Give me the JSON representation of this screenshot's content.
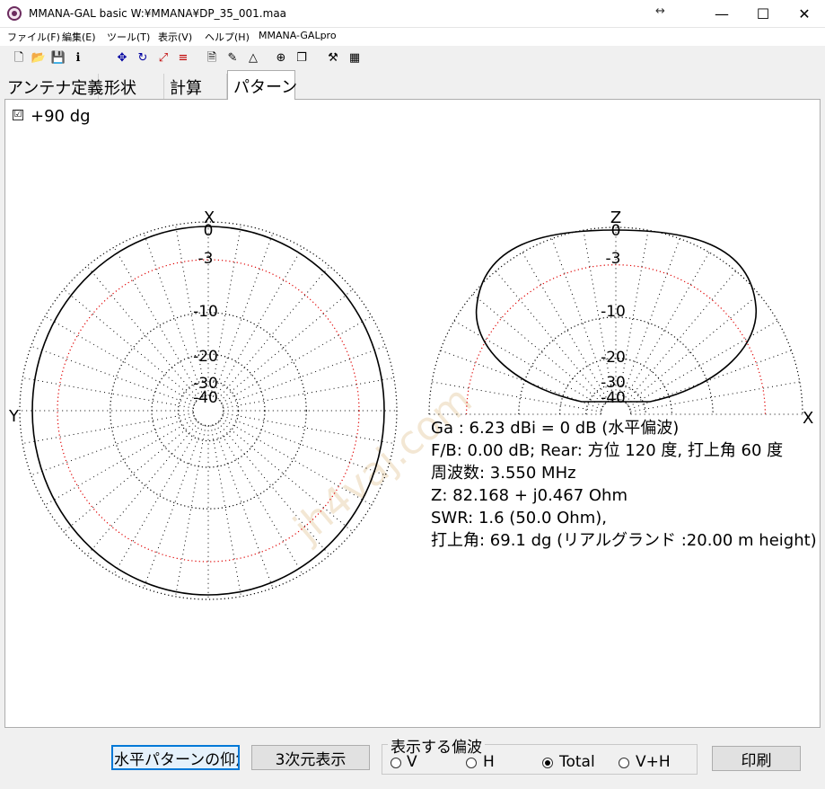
{
  "window": {
    "title": "MMANA-GAL basic  W:¥MMANA¥DP_35_001.maa",
    "minimize": "—",
    "maximize": "☐",
    "close": "✕",
    "resize_glyph": "↔"
  },
  "menu": [
    "ファイル(F)",
    "編集(E)",
    "ツール(T)",
    "表示(V)",
    "ヘルプ(H)",
    "MMANA-GALpro"
  ],
  "toolbar": [
    {
      "icon": "new-file-icon",
      "glyph": "🗋"
    },
    {
      "icon": "open-folder-icon",
      "glyph": "📂"
    },
    {
      "icon": "save-icon",
      "glyph": "💾"
    },
    {
      "icon": "info-icon",
      "glyph": "ℹ"
    },
    {
      "icon": "move-icon",
      "glyph": "✥"
    },
    {
      "icon": "rotate-icon",
      "glyph": "↻"
    },
    {
      "icon": "scale-icon",
      "glyph": "⤢"
    },
    {
      "icon": "wire-list-icon",
      "glyph": "≡"
    },
    {
      "icon": "document-icon",
      "glyph": "🗎"
    },
    {
      "icon": "edit-icon",
      "glyph": "✎"
    },
    {
      "icon": "triangle-icon",
      "glyph": "△"
    },
    {
      "icon": "target-icon",
      "glyph": "⊕"
    },
    {
      "icon": "copy-icon",
      "glyph": "❐"
    },
    {
      "icon": "tools-icon",
      "glyph": "⚒"
    },
    {
      "icon": "calculator-icon",
      "glyph": "▦"
    }
  ],
  "tabs": [
    "アンテナ定義",
    "形状",
    "計算",
    "パターン"
  ],
  "active_tab": 3,
  "pattern": {
    "checkbox_label": "+90 dg",
    "checkbox_checked": true,
    "horizontal_axis_top": "X",
    "horizontal_axis_left": "Y",
    "vertical_axis_top": "Z",
    "vertical_axis_right": "X",
    "ring_labels": [
      "0",
      "-3",
      "-10",
      "-20",
      "-30",
      "-40"
    ],
    "ring_fractions": [
      1.0,
      0.8,
      0.52,
      0.3,
      0.16,
      0.08
    ],
    "ring_colors": {
      "grid": "#000000",
      "minus3": "#e00000",
      "trace": "#000000"
    }
  },
  "info": {
    "line1": "Ga : 6.23 dBi = 0 dB  (水平偏波)",
    "line2": "F/B: 0.00 dB; Rear: 方位 120 度,  打上角 60 度",
    "line3": "周波数: 3.550 MHz",
    "line4": "Z: 82.168 + j0.467 Ohm",
    "line5": "SWR: 1.6 (50.0 Ohm),",
    "line6": "打上角: 69.1 dg (リアルグランド  :20.00 m height)"
  },
  "watermark": "jh4vaj.com",
  "bottom": {
    "elev_button": "水平パターンの仰角",
    "three_d_button": "3次元表示",
    "polarization_group": "表示する偏波",
    "radios": [
      {
        "label": "V",
        "checked": false
      },
      {
        "label": "H",
        "checked": false
      },
      {
        "label": "Total",
        "checked": true
      },
      {
        "label": "V+H",
        "checked": false
      }
    ],
    "print_button": "印刷"
  }
}
